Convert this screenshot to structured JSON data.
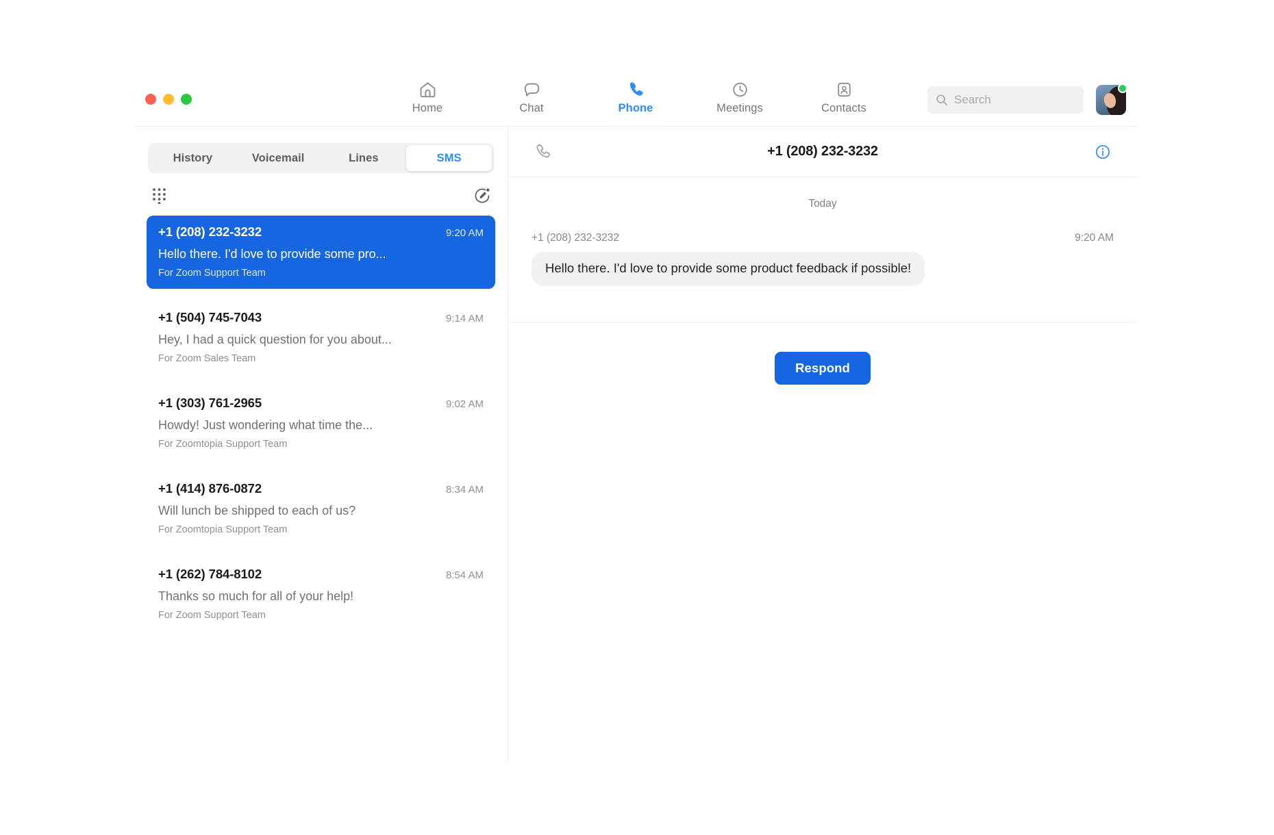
{
  "window": {
    "traffic_lights": [
      {
        "name": "close",
        "color": "#ff5f57"
      },
      {
        "name": "minimize",
        "color": "#febc2e"
      },
      {
        "name": "maximize",
        "color": "#28c840"
      }
    ]
  },
  "nav": {
    "items": [
      {
        "label": "Home",
        "icon": "home-icon",
        "active": false
      },
      {
        "label": "Chat",
        "icon": "chat-icon",
        "active": false
      },
      {
        "label": "Phone",
        "icon": "phone-icon",
        "active": true
      },
      {
        "label": "Meetings",
        "icon": "clock-icon",
        "active": false
      },
      {
        "label": "Contacts",
        "icon": "contacts-icon",
        "active": false
      }
    ],
    "active_color": "#2d8cff",
    "inactive_color": "#747677"
  },
  "search": {
    "placeholder": "Search",
    "value": "",
    "icon": "search-icon"
  },
  "profile": {
    "avatar": "user-avatar",
    "presence": "available",
    "presence_color": "#2ecc5f"
  },
  "tabs": {
    "items": [
      {
        "label": "History",
        "active": false
      },
      {
        "label": "Voicemail",
        "active": false
      },
      {
        "label": "Lines",
        "active": false
      },
      {
        "label": "SMS",
        "active": true
      }
    ],
    "active_color": "#2d8cff"
  },
  "actions": {
    "dialpad_icon": "dialpad-icon",
    "compose_icon": "compose-icon"
  },
  "conversations": [
    {
      "number": "+1 (208) 232-3232",
      "time": "9:20 AM",
      "preview": "Hello there. I'd love to provide some pro...",
      "line": "For Zoom Support Team",
      "selected": true
    },
    {
      "number": "+1 (504) 745-7043",
      "time": "9:14 AM",
      "preview": "Hey, I had a quick question for you about...",
      "line": "For Zoom Sales Team",
      "selected": false
    },
    {
      "number": "+1 (303) 761-2965",
      "time": "9:02 AM",
      "preview": "Howdy! Just wondering what time the...",
      "line": "For Zoomtopia Support Team",
      "selected": false
    },
    {
      "number": "+1 (414) 876-0872",
      "time": "8:34 AM",
      "preview": "Will lunch be shipped to each of us?",
      "line": "For Zoomtopia Support Team",
      "selected": false
    },
    {
      "number": "+1 (262) 784-8102",
      "time": "8:54 AM",
      "preview": "Thanks so much for all of your help!",
      "line": "For Zoom Support Team",
      "selected": false
    }
  ],
  "thread": {
    "title": "+1 (208) 232-3232",
    "call_icon": "phone-handset-icon",
    "info_icon": "info-circle-icon",
    "day_divider": "Today",
    "messages": [
      {
        "sender": "+1 (208) 232-3232",
        "time": "9:20 AM",
        "text": "Hello there. I'd love to provide some product feedback if possible!",
        "incoming": true
      }
    ],
    "respond_label": "Respond",
    "respond_color": "#1566e0"
  },
  "selected_conversation_color": "#1566e0"
}
